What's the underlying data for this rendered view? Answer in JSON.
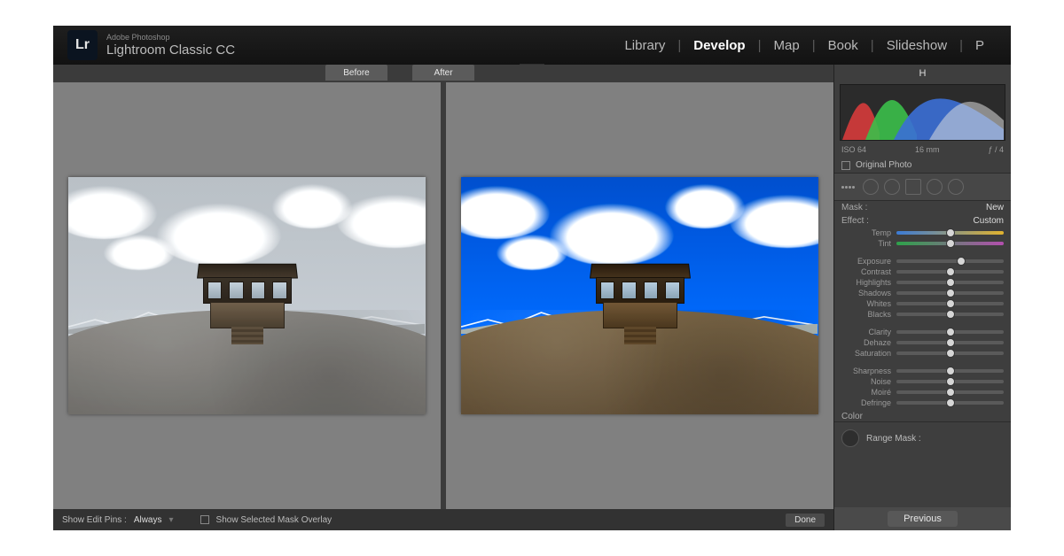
{
  "brand": {
    "logo": "Lr",
    "subtitle": "Adobe Photoshop",
    "title": "Lightroom Classic CC"
  },
  "modules": {
    "items": [
      "Library",
      "Develop",
      "Map",
      "Book",
      "Slideshow",
      "P"
    ],
    "active_index": 1
  },
  "compare": {
    "before_label": "Before",
    "after_label": "After"
  },
  "bottom": {
    "pins_label": "Show Edit Pins :",
    "pins_value": "Always",
    "overlay_label": "Show Selected Mask Overlay",
    "done_label": "Done"
  },
  "right": {
    "header_letter": "H",
    "histo_info": {
      "iso": "ISO 64",
      "lens": "16 mm",
      "f": "ƒ / 4"
    },
    "original_photo": "Original Photo",
    "mask_label": "Mask :",
    "mask_value": "New",
    "effect_label": "Effect :",
    "effect_value": "Custom",
    "sliders_a": [
      {
        "key": "temp",
        "label": "Temp",
        "pos": 0.5,
        "cls": "temp"
      },
      {
        "key": "tint",
        "label": "Tint",
        "pos": 0.5,
        "cls": "tint"
      }
    ],
    "sliders_b": [
      {
        "key": "exposure",
        "label": "Exposure",
        "pos": 0.6
      },
      {
        "key": "contrast",
        "label": "Contrast",
        "pos": 0.5
      },
      {
        "key": "highlights",
        "label": "Highlights",
        "pos": 0.5
      },
      {
        "key": "shadows",
        "label": "Shadows",
        "pos": 0.5
      },
      {
        "key": "whites",
        "label": "Whites",
        "pos": 0.5
      },
      {
        "key": "blacks",
        "label": "Blacks",
        "pos": 0.5
      }
    ],
    "sliders_c": [
      {
        "key": "clarity",
        "label": "Clarity",
        "pos": 0.5
      },
      {
        "key": "dehaze",
        "label": "Dehaze",
        "pos": 0.5
      },
      {
        "key": "saturation",
        "label": "Saturation",
        "pos": 0.5
      }
    ],
    "sliders_d": [
      {
        "key": "sharpness",
        "label": "Sharpness",
        "pos": 0.5
      },
      {
        "key": "noise",
        "label": "Noise",
        "pos": 0.5
      },
      {
        "key": "moire",
        "label": "Moiré",
        "pos": 0.5
      },
      {
        "key": "defringe",
        "label": "Defringe",
        "pos": 0.5
      }
    ],
    "color_label": "Color",
    "range_mask_label": "Range Mask :",
    "previous_label": "Previous"
  }
}
